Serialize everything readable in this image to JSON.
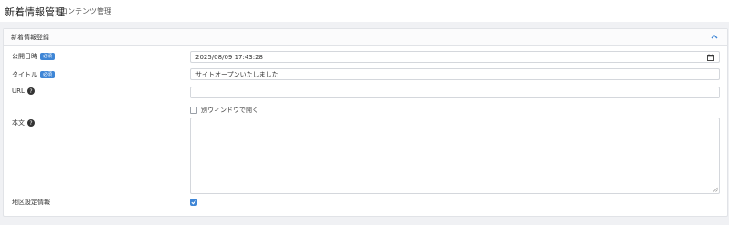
{
  "header": {
    "title": "新着情報管理",
    "subtitle": "コンテンツ管理"
  },
  "panel": {
    "title": "新着情報登録",
    "collapse_icon": "chevron-up-icon"
  },
  "fields": {
    "publish_date": {
      "label": "公開日時",
      "badge": "必須",
      "value": "2025/08/09 17:43:28",
      "icon": "calendar-icon"
    },
    "title": {
      "label": "タイトル",
      "badge": "必須",
      "value": "サイトオープンいたしました"
    },
    "url": {
      "label": "URL",
      "value": "",
      "help_icon": "question-circle-icon"
    },
    "new_window": {
      "label": "別ウィンドウで開く",
      "checked": false
    },
    "body": {
      "label": "本文",
      "value": "",
      "help_icon": "question-circle-icon"
    },
    "reflect": {
      "label": "地区設定情報",
      "checked": true
    }
  },
  "colors": {
    "accent": "#3f86d6",
    "background": "#f0f1f4",
    "border": "#d4d7dc"
  }
}
